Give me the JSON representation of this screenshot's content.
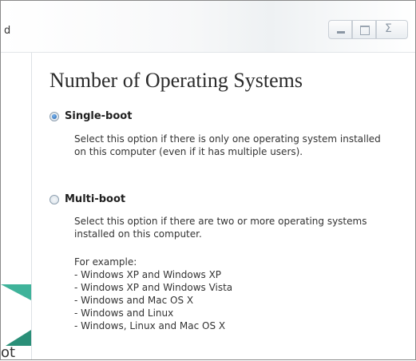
{
  "window": {
    "title_fragment": "d",
    "caption_buttons": [
      "minimize-icon",
      "maximize-icon",
      "close-icon"
    ],
    "close_glyph": "Σ"
  },
  "sidebar": {
    "text_fragment": "ot",
    "accent_colors": [
      "#3fb39a",
      "#2a8f78"
    ]
  },
  "page": {
    "heading": "Number of Operating Systems"
  },
  "options": {
    "single": {
      "label": "Single-boot",
      "selected": true,
      "description_line1": "Select this option if there is only one operating system installed",
      "description_line2": "on this computer (even if it has multiple users)."
    },
    "multi": {
      "label": "Multi-boot",
      "selected": false,
      "description_line1": "Select this option if there are two or more operating systems",
      "description_line2": "installed on this computer.",
      "example_heading": "For example:",
      "examples": [
        "- Windows XP and Windows XP",
        "- Windows XP and Windows Vista",
        "- Windows and Mac OS X",
        "- Windows and Linux",
        "- Windows, Linux and Mac OS X"
      ]
    }
  }
}
